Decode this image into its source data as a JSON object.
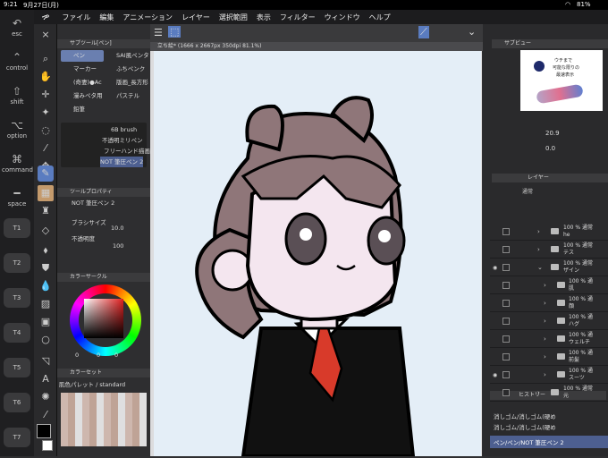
{
  "status": {
    "time": "9:21",
    "date": "9月27日(月)",
    "battery": "81%"
  },
  "menu": [
    "ファイル",
    "編集",
    "アニメーション",
    "レイヤー",
    "選択範囲",
    "表示",
    "フィルター",
    "ウィンドウ",
    "ヘルプ"
  ],
  "shortcuts": {
    "esc": "esc",
    "undo": "ctrl",
    "shift": "shift",
    "option": "option",
    "command": "command",
    "space": "space",
    "t": [
      "T1",
      "T2",
      "T3",
      "T4",
      "T5",
      "T6",
      "T7"
    ]
  },
  "doc_tab": "立ち絵* (1666 x 2667px 350dpi 81.1%)",
  "subtool": {
    "header": "サブツール[ペン]",
    "tabs": [
      "ペン",
      "SAI風ペンタ",
      "マーカー",
      "ふちペンク",
      "(奇妻)●Ac",
      "版画_長方形",
      "漫みペタ用",
      "パステル",
      "鉛筆"
    ],
    "brushes": [
      "6B brush",
      "不透明ミリペン",
      "フリーハンド描画",
      "NOT 筆圧ペン 2"
    ]
  },
  "toolprop": {
    "header": "ツールプロパティ",
    "name": "NOT 筆圧ペン 2",
    "size_label": "ブラシサイズ",
    "size_value": "10.0",
    "opacity_label": "不透明度",
    "opacity_value": "100"
  },
  "colorcircle": {
    "header": "カラーサークル",
    "values": [
      "0",
      "0",
      "0"
    ]
  },
  "colorset": {
    "header": "カラーセット",
    "name": "肌色パレット / standard"
  },
  "subview": {
    "header": "サブビュー",
    "note1": "ウチまで",
    "note2": "可能な限りの",
    "note3": "最速表示"
  },
  "navigator": {
    "zoom": "20.9",
    "angle": "0.0"
  },
  "layers": {
    "header": "レイヤー",
    "mode": "通常",
    "items": [
      {
        "pct": "100 %",
        "mode": "通常",
        "name": "he",
        "fold": true,
        "eye": false
      },
      {
        "pct": "100 %",
        "mode": "通常",
        "name": "テス",
        "fold": true,
        "eye": false
      },
      {
        "pct": "100 %",
        "mode": "通常",
        "name": "ザイン",
        "fold": true,
        "eye": true
      },
      {
        "pct": "100 %",
        "mode": "通",
        "name": "肌",
        "fold": true,
        "eye": false
      },
      {
        "pct": "100 %",
        "mode": "通",
        "name": "顔",
        "fold": true,
        "eye": false
      },
      {
        "pct": "100 %",
        "mode": "通",
        "name": "ハグ",
        "fold": true,
        "eye": false
      },
      {
        "pct": "100 %",
        "mode": "通",
        "name": "ウェルチ",
        "fold": true,
        "eye": false
      },
      {
        "pct": "100 %",
        "mode": "通",
        "name": "前髪",
        "fold": true,
        "eye": false
      },
      {
        "pct": "100 %",
        "mode": "通",
        "name": "スーツ",
        "fold": true,
        "eye": true
      },
      {
        "pct": "100 %",
        "mode": "通常",
        "name": "元",
        "fold": true,
        "eye": false
      }
    ]
  },
  "history": {
    "header": "ヒストリー",
    "items": [
      "消しゴム/消しゴム(硬め",
      "消しゴム/消しゴム(硬め",
      "ペン/ペン/NOT 筆圧ペン 2"
    ]
  }
}
